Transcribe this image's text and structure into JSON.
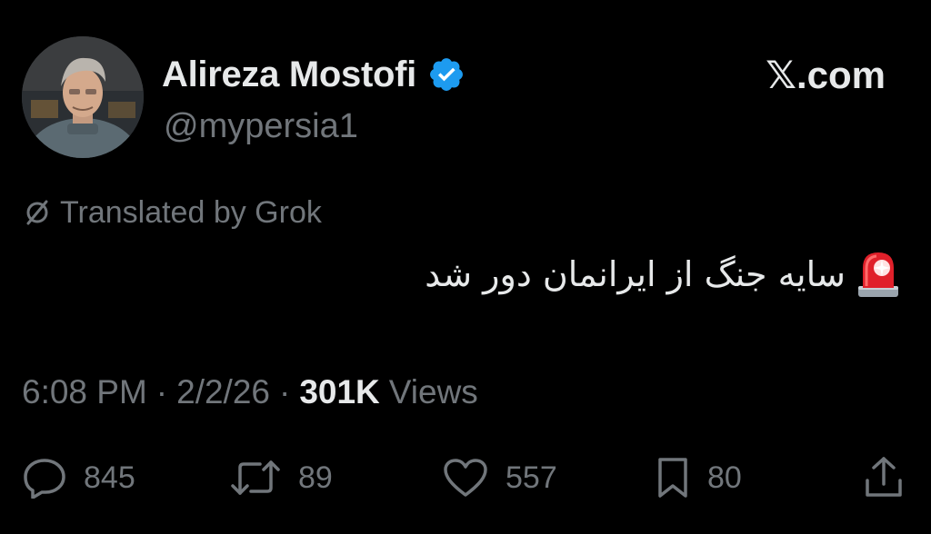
{
  "header": {
    "display_name": "Alireza Mostofi",
    "handle": "@mypersia1",
    "brand": "𝕏.com",
    "verified_icon": "verified-badge-icon",
    "verified_color": "#1d9bf0"
  },
  "translation_notice": "Translated by Grok",
  "tweet": {
    "text": "سایه جنگ از ایرانمان دور شد",
    "emoji_icon": "police-siren-icon"
  },
  "meta": {
    "time": "6:08 PM",
    "separator": "·",
    "date": "2/2/26",
    "views_count": "301K",
    "views_label": "Views"
  },
  "actions": {
    "replies": "845",
    "reposts": "89",
    "likes": "557",
    "bookmarks": "80"
  },
  "colors": {
    "background": "#000000",
    "primary_text": "#e7e9ea",
    "secondary_text": "#71767b"
  }
}
